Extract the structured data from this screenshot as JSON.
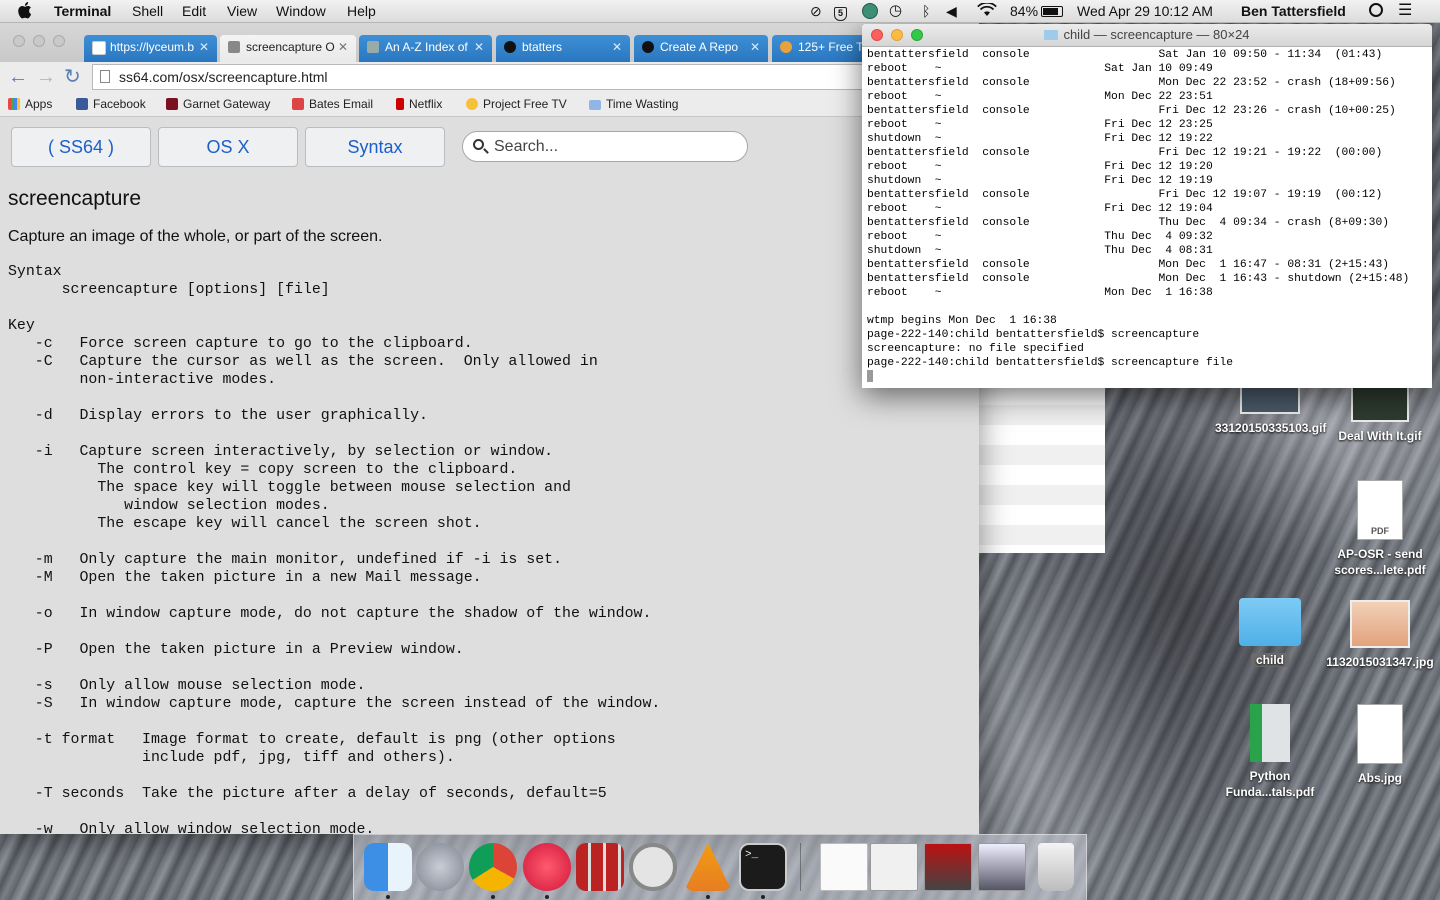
{
  "menubar": {
    "app_name": "Terminal",
    "menus": [
      "Shell",
      "Edit",
      "View",
      "Window",
      "Help"
    ],
    "battery": "84%",
    "datetime": "Wed Apr 29  10:12 AM",
    "user": "Ben Tattersfield"
  },
  "browser": {
    "tabs": [
      {
        "title": "https://lyceum.b"
      },
      {
        "title": "screencapture O"
      },
      {
        "title": "An A-Z Index of"
      },
      {
        "title": "btatters"
      },
      {
        "title": "Create A Repo"
      },
      {
        "title": "125+ Free Tu"
      }
    ],
    "url": "ss64.com/osx/screencapture.html",
    "bookmarks": [
      "Apps",
      "Facebook",
      "Garnet Gateway",
      "Bates Email",
      "Netflix",
      "Project Free TV",
      "Time Wasting"
    ]
  },
  "page": {
    "nav_buttons": [
      "( SS64 )",
      "OS X",
      "Syntax"
    ],
    "search_placeholder": "Search...",
    "title": "screencapture",
    "description": "Capture an image of the whole, or part of the screen.",
    "lines": [
      "Syntax",
      "      screencapture [options] [file]",
      "",
      "Key",
      "   -c   Force screen capture to go to the clipboard.",
      "   -C   Capture the cursor as well as the screen.  Only allowed in",
      "        non-interactive modes.",
      "",
      "   -d   Display errors to the user graphically.",
      "",
      "   -i   Capture screen interactively, by selection or window.",
      "          The control key = copy screen to the clipboard.",
      "          The space key will toggle between mouse selection and",
      "             window selection modes.",
      "          The escape key will cancel the screen shot.",
      "",
      "   -m   Only capture the main monitor, undefined if -i is set.",
      "   -M   Open the taken picture in a new Mail message.",
      "",
      "   -o   In window capture mode, do not capture the shadow of the window.",
      "",
      "   -P   Open the taken picture in a Preview window.",
      "",
      "   -s   Only allow mouse selection mode.",
      "   -S   In window capture mode, capture the screen instead of the window.",
      "",
      "   -t format   Image format to create, default is png (other options",
      "               include pdf, jpg, tiff and others).",
      "",
      "   -T seconds  Take the picture after a delay of seconds, default=5",
      "",
      "   -w   Only allow window selection mode."
    ]
  },
  "terminal": {
    "title": "child — screencapture — 80×24",
    "lines": [
      "bentattersfield  console                   Sat Jan 10 09:50 - 11:34  (01:43)",
      "reboot    ~                        Sat Jan 10 09:49",
      "bentattersfield  console                   Mon Dec 22 23:52 - crash (18+09:56)",
      "reboot    ~                        Mon Dec 22 23:51",
      "bentattersfield  console                   Fri Dec 12 23:26 - crash (10+00:25)",
      "reboot    ~                        Fri Dec 12 23:25",
      "shutdown  ~                        Fri Dec 12 19:22",
      "bentattersfield  console                   Fri Dec 12 19:21 - 19:22  (00:00)",
      "reboot    ~                        Fri Dec 12 19:20",
      "shutdown  ~                        Fri Dec 12 19:19",
      "bentattersfield  console                   Fri Dec 12 19:07 - 19:19  (00:12)",
      "reboot    ~                        Fri Dec 12 19:04",
      "bentattersfield  console                   Thu Dec  4 09:34 - crash (8+09:30)",
      "reboot    ~                        Thu Dec  4 09:32",
      "shutdown  ~                        Thu Dec  4 08:31",
      "bentattersfield  console                   Mon Dec  1 16:47 - 08:31 (2+15:43)",
      "bentattersfield  console                   Mon Dec  1 16:43 - shutdown (2+15:48)",
      "reboot    ~                        Mon Dec  1 16:38",
      "",
      "wtmp begins Mon Dec  1 16:38",
      "page-222-140:child bentattersfield$ screencapture",
      "screencapture: no file specified",
      "page-222-140:child bentattersfield$ screencapture file"
    ]
  },
  "desktop": {
    "icons": [
      {
        "label": "33120150335103.gif"
      },
      {
        "label": "Deal With It.gif"
      },
      {
        "label": "AP-OSR - send scores...lete.pdf"
      },
      {
        "label": "child"
      },
      {
        "label": "1132015031347.jpg"
      },
      {
        "label": "Python Funda...tals.pdf"
      },
      {
        "label": "Abs.jpg"
      }
    ],
    "pdf_badge": "PDF"
  },
  "dock": {
    "apps": [
      "finder-icon",
      "launchpad-icon",
      "chrome-icon",
      "itunes-icon",
      "photo-booth-icon",
      "blocked-app-icon",
      "vlc-icon",
      "terminal-icon"
    ],
    "terminal_glyph": ">_"
  }
}
